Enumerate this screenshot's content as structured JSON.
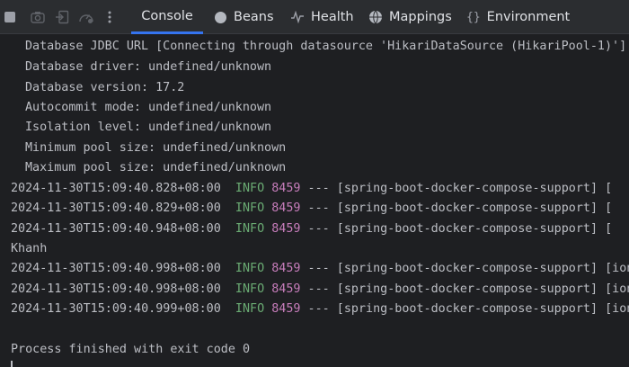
{
  "tabs": [
    {
      "label": "Console",
      "icon": "none",
      "active": true
    },
    {
      "label": "Beans",
      "icon": "bean-icon"
    },
    {
      "label": "Health",
      "icon": "pulse-icon"
    },
    {
      "label": "Mappings",
      "icon": "globe-icon"
    },
    {
      "label": "Environment",
      "icon": "braces-icon"
    }
  ],
  "toolbar_icons": [
    "stop-icon",
    "camera-icon",
    "exit-icon",
    "gauge-icon",
    "more-vertical-icon"
  ],
  "console": {
    "datasource_lines": [
      "Database JDBC URL [Connecting through datasource 'HikariDataSource (HikariPool-1)']",
      "Database driver: undefined/unknown",
      "Database version: 17.2",
      "Autocommit mode: undefined/unknown",
      "Isolation level: undefined/unknown",
      "Minimum pool size: undefined/unknown",
      "Maximum pool size: undefined/unknown"
    ],
    "log_block1": [
      {
        "ts": "2024-11-30T15:09:40.828+08:00",
        "level": "INFO",
        "pid": "8459",
        "rest": " --- [spring-boot-docker-compose-support] ["
      },
      {
        "ts": "2024-11-30T15:09:40.829+08:00",
        "level": "INFO",
        "pid": "8459",
        "rest": " --- [spring-boot-docker-compose-support] ["
      },
      {
        "ts": "2024-11-30T15:09:40.948+08:00",
        "level": "INFO",
        "pid": "8459",
        "rest": " --- [spring-boot-docker-compose-support] ["
      }
    ],
    "plain_line": "Khanh",
    "log_block2": [
      {
        "ts": "2024-11-30T15:09:40.998+08:00",
        "level": "INFO",
        "pid": "8459",
        "rest": " --- [spring-boot-docker-compose-support] [ion"
      },
      {
        "ts": "2024-11-30T15:09:40.998+08:00",
        "level": "INFO",
        "pid": "8459",
        "rest": " --- [spring-boot-docker-compose-support] [ion"
      },
      {
        "ts": "2024-11-30T15:09:40.999+08:00",
        "level": "INFO",
        "pid": "8459",
        "rest": " --- [spring-boot-docker-compose-support] [ion"
      }
    ],
    "exit_line": "Process finished with exit code 0"
  },
  "colors": {
    "accent": "#3574f0",
    "info": "#6aab73",
    "pid": "#c77dbb",
    "text": "#bcbec4",
    "background": "#1e1f22"
  }
}
